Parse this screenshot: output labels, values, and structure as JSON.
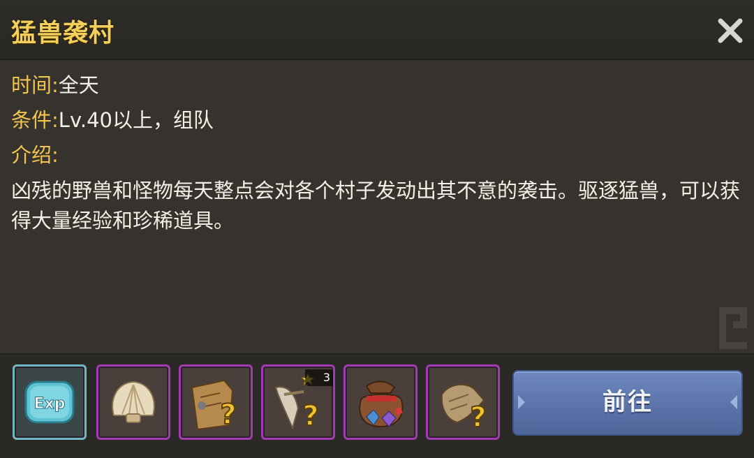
{
  "dialog": {
    "title": "猛兽袭村",
    "close_icon": "close-x-icon"
  },
  "info": {
    "time_label": "时间:",
    "time_value": "全天",
    "condition_label": "条件:",
    "condition_value": "Lv.40以上，组队",
    "intro_label": "介绍:",
    "description": "凶残的野兽和怪物每天整点会对各个村子发动出其不意的袭击。驱逐猛兽，可以获得大量经验和珍稀道具。"
  },
  "rewards": [
    {
      "icon": "exp-icon",
      "label": "Exp",
      "border": "#6fb8c4"
    },
    {
      "icon": "shell-icon",
      "border": "#a13bb0"
    },
    {
      "icon": "mystery-map-icon",
      "border": "#a13bb0"
    },
    {
      "icon": "mystery-weapon-icon",
      "border": "#a13bb0",
      "badge": "3"
    },
    {
      "icon": "gem-bag-icon",
      "border": "#a13bb0"
    },
    {
      "icon": "mystery-scroll-icon",
      "border": "#a13bb0"
    }
  ],
  "actions": {
    "go_label": "前往"
  },
  "colors": {
    "title": "#f4cf5a",
    "label": "#f2c44e",
    "button": "#5a74a9"
  }
}
